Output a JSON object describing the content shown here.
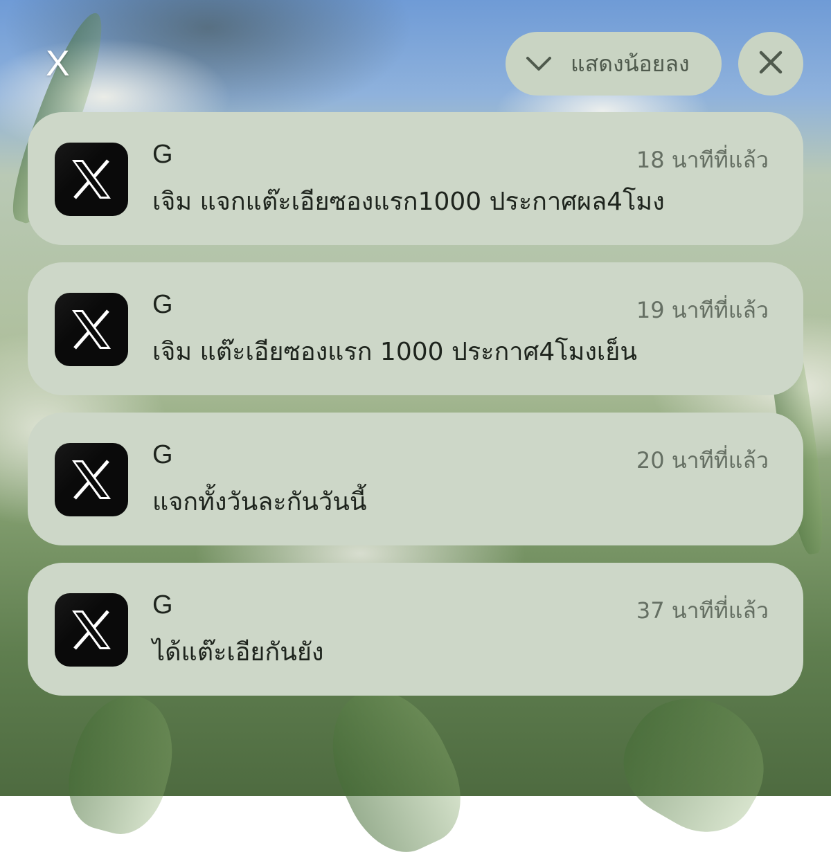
{
  "top_bar": {
    "close_label": "X",
    "show_less_label": "แสดงน้อยลง",
    "chevron_icon": "chevron-down-icon",
    "clear_icon": "close-icon"
  },
  "colors": {
    "card_bg": "#cdd7c8",
    "pill_bg": "#c9d4c3",
    "app_icon_bg": "#0a0a0a"
  },
  "notifications": [
    {
      "app_icon": "x-logo-icon",
      "sender": "G",
      "time": "18 นาทีที่แล้ว",
      "message": "เจิม แจกแต๊ะเอียซองแรก1000 ประกาศผล4โมง"
    },
    {
      "app_icon": "x-logo-icon",
      "sender": "G",
      "time": "19 นาทีที่แล้ว",
      "message": "เจิม แต๊ะเอียซองแรก 1000 ประกาศ4โมงเย็น"
    },
    {
      "app_icon": "x-logo-icon",
      "sender": "G",
      "time": "20 นาทีที่แล้ว",
      "message": "แจกทั้งวันละกันวันนี้"
    },
    {
      "app_icon": "x-logo-icon",
      "sender": "G",
      "time": "37 นาทีที่แล้ว",
      "message": "ได้แต๊ะเอียกันยัง"
    }
  ]
}
